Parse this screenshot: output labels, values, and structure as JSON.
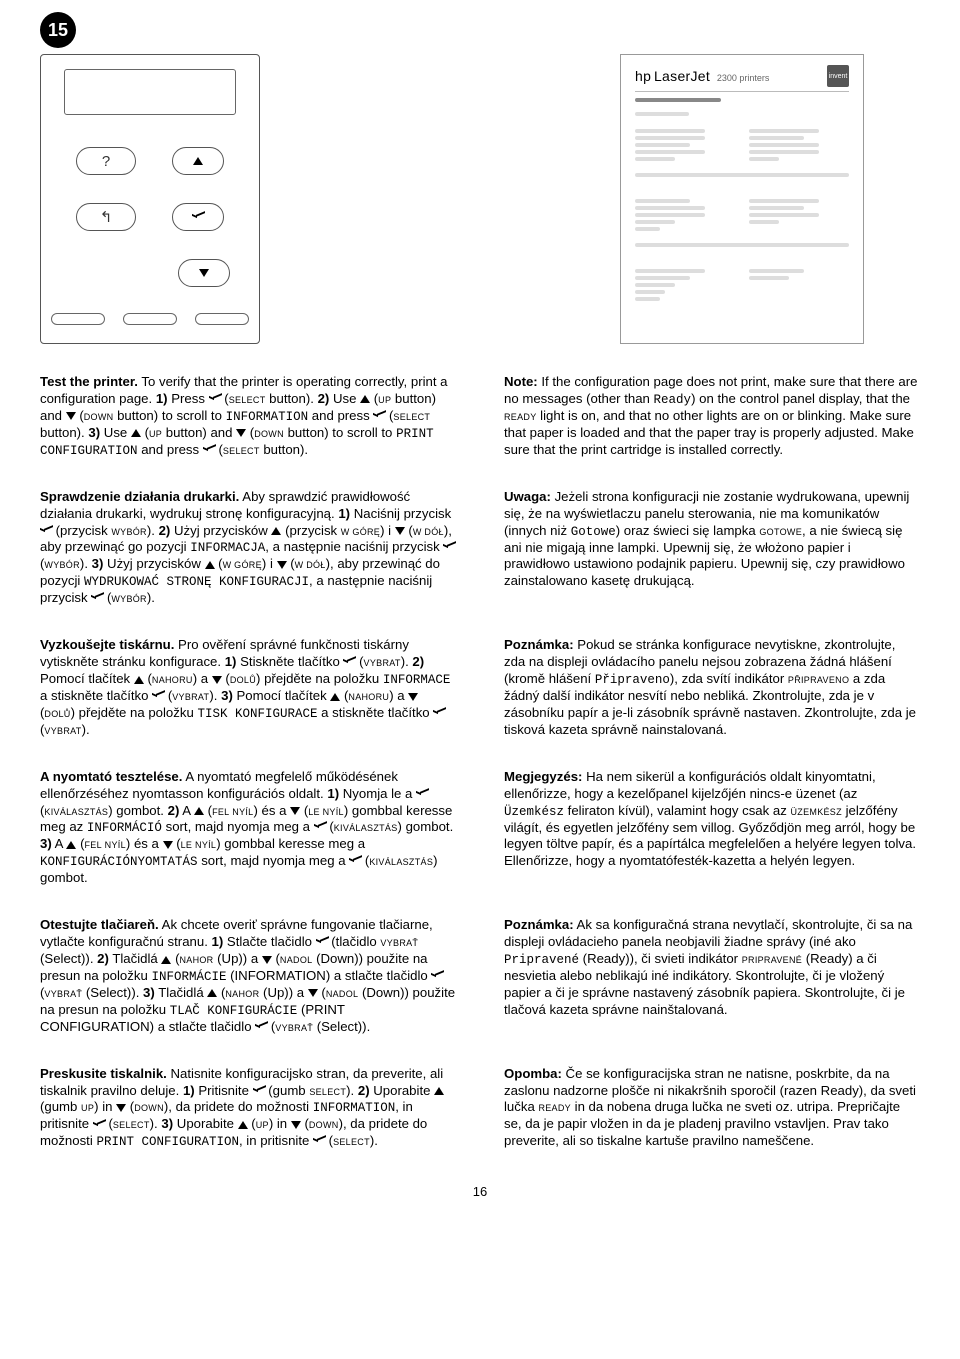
{
  "step_number": "15",
  "page_number": "16",
  "printout_header": {
    "brand": "hp",
    "model": "LaserJet",
    "variant": "2300 printers"
  },
  "hp_box_label": "invent",
  "icons": {
    "select": "check",
    "up": "triangle-up",
    "down": "triangle-down"
  },
  "rows": [
    {
      "left": {
        "lead": "Test the printer.",
        "body_1": " To verify that the printer is operating correctly, print a configuration page. ",
        "s1": "1)",
        "s1_a": " Press ",
        "s1_b": " (",
        "s1_btn": "Select",
        "s1_c": " button). ",
        "s2": "2)",
        "s2_a": " Use ",
        "s2_b": " (",
        "s2_btn1": "Up",
        "s2_c": " button) and ",
        "s2_btn2": "Down",
        "s2_d": " button) to scroll to ",
        "s2_menu": "INFORMATION",
        "s2_e": " and press ",
        "s2_btn3": "Select",
        "s2_f": " button). ",
        "s3": "3)",
        "s3_a": " Use ",
        "s3_btn1": "Up",
        "s3_b": " button) and ",
        "s3_btn2": "Down",
        "s3_c": " button) to scroll to ",
        "s3_menu": "PRINT CONFIGURATION",
        "s3_d": " and press ",
        "s3_btn3": "Select",
        "s3_e": " button)."
      },
      "right": {
        "lead": "Note:",
        "body_a": " If the configuration page does not print, make sure that there are no messages (other than ",
        "mono": "Ready",
        "body_b": ") on the control panel display, that the ",
        "sc": "Ready",
        "body_c": " light is on, and that no other lights are on or blinking. Make sure that paper is loaded and that the paper tray is properly adjusted. Make sure that the print cartridge is installed correctly."
      }
    },
    {
      "left": {
        "lead": "Sprawdzenie działania drukarki.",
        "body_1": " Aby sprawdzić prawidłowość działania drukarki, wydrukuj stronę konfiguracyjną. ",
        "s1": "1)",
        "s1_a": " Naciśnij przycisk ",
        "s1_b": " (przycisk ",
        "s1_btn": "Wybór",
        "s1_c": "). ",
        "s2": "2)",
        "s2_a": " Użyj przycisków ",
        "s2_b": " (przycisk ",
        "s2_btn1": "W górę",
        "s2_c": ") i ",
        "s2_btn2": "W dół",
        "s2_d": "), aby przewinąć go pozycji ",
        "s2_menu": "INFORMACJA",
        "s2_e": ", a następnie naciśnij przycisk ",
        "s2_btn3": "Wybór",
        "s2_f": "). ",
        "s3": "3)",
        "s3_a": " Użyj przycisków ",
        "s3_btn1": "W górę",
        "s3_b": ") i ",
        "s3_btn2": "W dół",
        "s3_c": "), aby przewinąć do pozycji ",
        "s3_menu": "WYDRUKOWAĆ STRONĘ KONFIGURACJI",
        "s3_d": ", a następnie naciśnij przycisk ",
        "s3_btn3": "Wybór",
        "s3_e": ")."
      },
      "right": {
        "lead": "Uwaga:",
        "body_a": " Jeżeli strona konfiguracji nie zostanie wydrukowana, upewnij się, że na wyświetlaczu panelu sterowania, nie ma komunikatów (innych niż ",
        "mono": "Gotowe",
        "body_b": ") oraz świeci się lampka ",
        "sc": "Gotowe",
        "body_c": ", a nie świecą się ani nie migają inne lampki. Upewnij się, że włożono papier i prawidłowo ustawiono podajnik papieru. Upewnij się, czy prawidłowo zainstalowano kasetę drukującą."
      }
    },
    {
      "left": {
        "lead": "Vyzkoušejte tiskárnu.",
        "body_1": " Pro ověření správné funkčnosti tiskárny vytiskněte stránku konfigurace. ",
        "s1": "1)",
        "s1_a": " Stiskněte tlačítko ",
        "s1_b": " (",
        "s1_btn": "Vybrat",
        "s1_c": "). ",
        "s2": "2)",
        "s2_a": " Pomocí tlačítek ",
        "s2_b": " (",
        "s2_btn1": "Nahoru",
        "s2_c": ") a ",
        "s2_btn2": "Dolů",
        "s2_d": ") přejděte na položku ",
        "s2_menu": "INFORMACE",
        "s2_e": " a stiskněte tlačítko ",
        "s2_btn3": "Vybrat",
        "s2_f": "). ",
        "s3": "3)",
        "s3_a": " Pomocí tlačítek ",
        "s3_btn1": "Nahoru",
        "s3_b": ") a ",
        "s3_btn2": "Dolů",
        "s3_c": ") přejděte na položku ",
        "s3_menu": "TISK KONFIGURACE",
        "s3_d": " a stiskněte tlačítko ",
        "s3_btn3": "Vybrat",
        "s3_e": ")."
      },
      "right": {
        "lead": "Poznámka:",
        "body_a": " Pokud se stránka konfigurace nevytiskne, zkontrolujte, zda na displeji ovládacího panelu nejsou zobrazena žádná hlášení (kromě hlášení ",
        "mono": "Připraveno",
        "body_b": "), zda svítí indikátor ",
        "sc": "Připraveno",
        "body_c": " a zda žádný další indikátor nesvítí nebo nebliká. Zkontrolujte, zda je v zásobníku papír a je-li zásobník správně nastaven. Zkontrolujte, zda je tisková kazeta správně nainstalovaná."
      }
    },
    {
      "left": {
        "lead": "A nyomtató tesztelése.",
        "body_1": " A nyomtató megfelelő működésének ellenőrzéséhez nyomtasson konfigurációs oldalt. ",
        "s1": "1)",
        "s1_a": " Nyomja le a ",
        "s1_b": " (",
        "s1_btn": "Kiválasztás",
        "s1_c": ") gombot. ",
        "s2": "2)",
        "s2_a": " A ",
        "s2_b": " (",
        "s2_btn1": "Fel nyíl",
        "s2_c": ") és a ",
        "s2_btn2": "Le nyíl",
        "s2_d": ") gombbal keresse meg az ",
        "s2_menu": "INFORMÁCIÓ",
        "s2_e": " sort, majd nyomja meg a ",
        "s2_btn3": "Kiválasztás",
        "s2_f": ") gombot. ",
        "s3": "3)",
        "s3_a": " A ",
        "s3_btn1": "Fel nyíl",
        "s3_b": ") és a ",
        "s3_btn2": "Le nyíl",
        "s3_c": ") gombbal keresse meg a ",
        "s3_menu": "KONFIGURÁCIÓNYOMTATÁS",
        "s3_d": " sort, majd nyomja meg a ",
        "s3_btn3": "Kiválasztás",
        "s3_e": ") gombot."
      },
      "right": {
        "lead": "Megjegyzés:",
        "body_a": " Ha nem sikerül a konfigurációs oldalt kinyomtatni, ellenőrizze, hogy a kezelőpanel kijelzőjén nincs-e üzenet (az ",
        "mono": "Üzemkész",
        "body_b": " feliraton kívül), valamint hogy csak az ",
        "sc": "Üzemkész",
        "body_c": " jelzőfény világít, és egyetlen jelzőfény sem villog. Győződjön meg arról, hogy be legyen töltve papír, és a papírtálca megfelelően a helyére legyen tolva. Ellenőrizze, hogy a nyomtatófesték-kazetta a helyén legyen."
      }
    },
    {
      "left": {
        "lead": "Otestujte tlačiareň.",
        "body_1": " Ak chcete overiť správne fungovanie tlačiarne, vytlačte konfiguračnú stranu. ",
        "s1": "1)",
        "s1_a": " Stlačte tlačidlo ",
        "s1_b": " (tlačidlo ",
        "s1_btn": "Vybrať",
        "s1_c": " (Select)). ",
        "s2": "2)",
        "s2_a": " Tlačidlá ",
        "s2_b": " (",
        "s2_btn1": "Nahor",
        "s2_c": " (Up)) a ",
        "s2_btn2": "Nadol",
        "s2_d": " (Down)) použite na presun na položku ",
        "s2_menu": "INFORMÁCIE",
        "s2_e": " (INFORMATION) a stlačte tlačidlo ",
        "s2_btn3": "Vybrať",
        "s2_f": " (Select)). ",
        "s3": "3)",
        "s3_a": " Tlačidlá ",
        "s3_btn1": "Nahor",
        "s3_b": " (Up)) a ",
        "s3_btn2": "Nadol",
        "s3_c": " (Down)) použite na presun na položku ",
        "s3_menu": "TLAČ KONFIGURÁCIE",
        "s3_d": " (PRINT CONFIGURATION) a stlačte tlačidlo ",
        "s3_btn3": "Vybrať",
        "s3_e": " (Select))."
      },
      "right": {
        "lead": "Poznámka:",
        "body_a": " Ak sa konfiguračná strana nevytlačí, skontrolujte, či sa na displeji ovládacieho panela neobjavili žiadne správy (iné ako ",
        "mono": "Pripravené",
        "body_b": " (Ready)), či svieti indikátor ",
        "sc": "Pripravené",
        "body_c": " (Ready) a či nesvietia alebo neblikajú iné indikátory. Skontrolujte, či je vložený papier a či je správne nastavený zásobník papiera. Skontrolujte, či je tlačová kazeta správne nainštalovaná."
      }
    },
    {
      "left": {
        "lead": "Preskusite tiskalnik.",
        "body_1": " Natisnite konfiguracijsko stran, da preverite, ali tiskalnik pravilno deluje. ",
        "s1": "1)",
        "s1_a": " Pritisnite ",
        "s1_b": " (gumb ",
        "s1_btn": "Select",
        "s1_c": "). ",
        "s2": "2)",
        "s2_a": " Uporabite ",
        "s2_b": " (gumb ",
        "s2_btn1": "Up",
        "s2_c": ") in ",
        "s2_btn2": "Down",
        "s2_d": "), da pridete do možnosti ",
        "s2_menu": "INFORMATION",
        "s2_e": ", in pritisnite ",
        "s2_btn3": "Select",
        "s2_f": "). ",
        "s3": "3)",
        "s3_a": " Uporabite ",
        "s3_btn1": "Up",
        "s3_b": ") in ",
        "s3_btn2": "Down",
        "s3_c": "), da pridete do možnosti ",
        "s3_menu": "PRINT CONFIGURATION",
        "s3_d": ", in pritisnite ",
        "s3_btn3": "Select",
        "s3_e": ")."
      },
      "right": {
        "lead": "Opomba:",
        "body_a": " Če se konfiguracijska stran ne natisne, poskrbite, da na zaslonu nadzorne plošče ni nikakršnih sporočil (razen Ready), da sveti lučka ",
        "mono": "",
        "body_b": "",
        "sc": "Ready",
        "body_c": " in da nobena druga lučka ne sveti oz. utripa. Prepričajte se, da je papir vložen in da je pladenj pravilno vstavljen. Prav tako preverite, ali so tiskalne kartuše pravilno nameščene."
      }
    }
  ]
}
